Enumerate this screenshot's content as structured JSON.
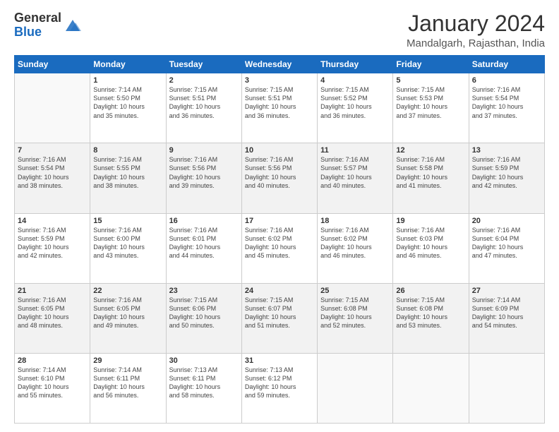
{
  "header": {
    "logo_general": "General",
    "logo_blue": "Blue",
    "month_title": "January 2024",
    "location": "Mandalgarh, Rajasthan, India"
  },
  "days_of_week": [
    "Sunday",
    "Monday",
    "Tuesday",
    "Wednesday",
    "Thursday",
    "Friday",
    "Saturday"
  ],
  "weeks": [
    [
      {
        "day": "",
        "sunrise": "",
        "sunset": "",
        "daylight": "",
        "empty": true
      },
      {
        "day": "1",
        "sunrise": "Sunrise: 7:14 AM",
        "sunset": "Sunset: 5:50 PM",
        "daylight": "Daylight: 10 hours and 35 minutes."
      },
      {
        "day": "2",
        "sunrise": "Sunrise: 7:15 AM",
        "sunset": "Sunset: 5:51 PM",
        "daylight": "Daylight: 10 hours and 36 minutes."
      },
      {
        "day": "3",
        "sunrise": "Sunrise: 7:15 AM",
        "sunset": "Sunset: 5:51 PM",
        "daylight": "Daylight: 10 hours and 36 minutes."
      },
      {
        "day": "4",
        "sunrise": "Sunrise: 7:15 AM",
        "sunset": "Sunset: 5:52 PM",
        "daylight": "Daylight: 10 hours and 36 minutes."
      },
      {
        "day": "5",
        "sunrise": "Sunrise: 7:15 AM",
        "sunset": "Sunset: 5:53 PM",
        "daylight": "Daylight: 10 hours and 37 minutes."
      },
      {
        "day": "6",
        "sunrise": "Sunrise: 7:16 AM",
        "sunset": "Sunset: 5:54 PM",
        "daylight": "Daylight: 10 hours and 37 minutes."
      }
    ],
    [
      {
        "day": "7",
        "sunrise": "Sunrise: 7:16 AM",
        "sunset": "Sunset: 5:54 PM",
        "daylight": "Daylight: 10 hours and 38 minutes."
      },
      {
        "day": "8",
        "sunrise": "Sunrise: 7:16 AM",
        "sunset": "Sunset: 5:55 PM",
        "daylight": "Daylight: 10 hours and 38 minutes."
      },
      {
        "day": "9",
        "sunrise": "Sunrise: 7:16 AM",
        "sunset": "Sunset: 5:56 PM",
        "daylight": "Daylight: 10 hours and 39 minutes."
      },
      {
        "day": "10",
        "sunrise": "Sunrise: 7:16 AM",
        "sunset": "Sunset: 5:56 PM",
        "daylight": "Daylight: 10 hours and 40 minutes."
      },
      {
        "day": "11",
        "sunrise": "Sunrise: 7:16 AM",
        "sunset": "Sunset: 5:57 PM",
        "daylight": "Daylight: 10 hours and 40 minutes."
      },
      {
        "day": "12",
        "sunrise": "Sunrise: 7:16 AM",
        "sunset": "Sunset: 5:58 PM",
        "daylight": "Daylight: 10 hours and 41 minutes."
      },
      {
        "day": "13",
        "sunrise": "Sunrise: 7:16 AM",
        "sunset": "Sunset: 5:59 PM",
        "daylight": "Daylight: 10 hours and 42 minutes."
      }
    ],
    [
      {
        "day": "14",
        "sunrise": "Sunrise: 7:16 AM",
        "sunset": "Sunset: 5:59 PM",
        "daylight": "Daylight: 10 hours and 42 minutes."
      },
      {
        "day": "15",
        "sunrise": "Sunrise: 7:16 AM",
        "sunset": "Sunset: 6:00 PM",
        "daylight": "Daylight: 10 hours and 43 minutes."
      },
      {
        "day": "16",
        "sunrise": "Sunrise: 7:16 AM",
        "sunset": "Sunset: 6:01 PM",
        "daylight": "Daylight: 10 hours and 44 minutes."
      },
      {
        "day": "17",
        "sunrise": "Sunrise: 7:16 AM",
        "sunset": "Sunset: 6:02 PM",
        "daylight": "Daylight: 10 hours and 45 minutes."
      },
      {
        "day": "18",
        "sunrise": "Sunrise: 7:16 AM",
        "sunset": "Sunset: 6:02 PM",
        "daylight": "Daylight: 10 hours and 46 minutes."
      },
      {
        "day": "19",
        "sunrise": "Sunrise: 7:16 AM",
        "sunset": "Sunset: 6:03 PM",
        "daylight": "Daylight: 10 hours and 46 minutes."
      },
      {
        "day": "20",
        "sunrise": "Sunrise: 7:16 AM",
        "sunset": "Sunset: 6:04 PM",
        "daylight": "Daylight: 10 hours and 47 minutes."
      }
    ],
    [
      {
        "day": "21",
        "sunrise": "Sunrise: 7:16 AM",
        "sunset": "Sunset: 6:05 PM",
        "daylight": "Daylight: 10 hours and 48 minutes."
      },
      {
        "day": "22",
        "sunrise": "Sunrise: 7:16 AM",
        "sunset": "Sunset: 6:05 PM",
        "daylight": "Daylight: 10 hours and 49 minutes."
      },
      {
        "day": "23",
        "sunrise": "Sunrise: 7:15 AM",
        "sunset": "Sunset: 6:06 PM",
        "daylight": "Daylight: 10 hours and 50 minutes."
      },
      {
        "day": "24",
        "sunrise": "Sunrise: 7:15 AM",
        "sunset": "Sunset: 6:07 PM",
        "daylight": "Daylight: 10 hours and 51 minutes."
      },
      {
        "day": "25",
        "sunrise": "Sunrise: 7:15 AM",
        "sunset": "Sunset: 6:08 PM",
        "daylight": "Daylight: 10 hours and 52 minutes."
      },
      {
        "day": "26",
        "sunrise": "Sunrise: 7:15 AM",
        "sunset": "Sunset: 6:08 PM",
        "daylight": "Daylight: 10 hours and 53 minutes."
      },
      {
        "day": "27",
        "sunrise": "Sunrise: 7:14 AM",
        "sunset": "Sunset: 6:09 PM",
        "daylight": "Daylight: 10 hours and 54 minutes."
      }
    ],
    [
      {
        "day": "28",
        "sunrise": "Sunrise: 7:14 AM",
        "sunset": "Sunset: 6:10 PM",
        "daylight": "Daylight: 10 hours and 55 minutes."
      },
      {
        "day": "29",
        "sunrise": "Sunrise: 7:14 AM",
        "sunset": "Sunset: 6:11 PM",
        "daylight": "Daylight: 10 hours and 56 minutes."
      },
      {
        "day": "30",
        "sunrise": "Sunrise: 7:13 AM",
        "sunset": "Sunset: 6:11 PM",
        "daylight": "Daylight: 10 hours and 58 minutes."
      },
      {
        "day": "31",
        "sunrise": "Sunrise: 7:13 AM",
        "sunset": "Sunset: 6:12 PM",
        "daylight": "Daylight: 10 hours and 59 minutes."
      },
      {
        "day": "",
        "sunrise": "",
        "sunset": "",
        "daylight": "",
        "empty": true
      },
      {
        "day": "",
        "sunrise": "",
        "sunset": "",
        "daylight": "",
        "empty": true
      },
      {
        "day": "",
        "sunrise": "",
        "sunset": "",
        "daylight": "",
        "empty": true
      }
    ]
  ]
}
